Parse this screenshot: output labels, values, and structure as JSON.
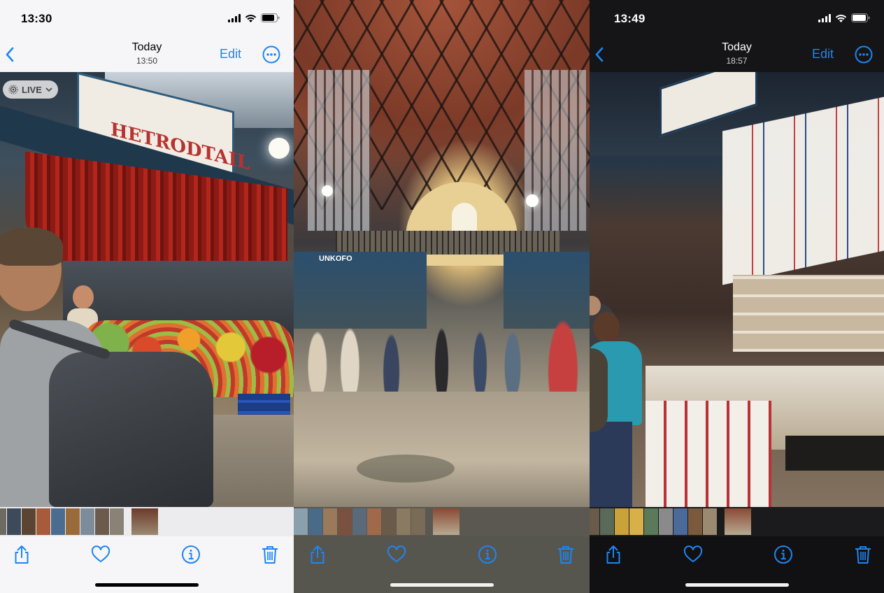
{
  "screens": [
    {
      "time": "13:30",
      "nav_title": "Today",
      "nav_subtitle": "13:50",
      "edit_label": "Edit",
      "live_label": "LIVE",
      "sign_text": "HETRODTAIL",
      "theme": "light",
      "accent": "#1c86f2"
    },
    {
      "theme": "dark-overlay",
      "sign_text": "UNKOFO",
      "accent": "#1c86f2"
    },
    {
      "time": "13:49",
      "nav_title": "Today",
      "nav_subtitle": "18:57",
      "edit_label": "Edit",
      "theme": "dark",
      "accent": "#1c86f2"
    }
  ],
  "toolbar_icons": [
    "share-icon",
    "heart-icon",
    "info-icon",
    "trash-icon"
  ],
  "system_icons": [
    "cellular-signal-icon",
    "wifi-icon",
    "battery-icon"
  ]
}
